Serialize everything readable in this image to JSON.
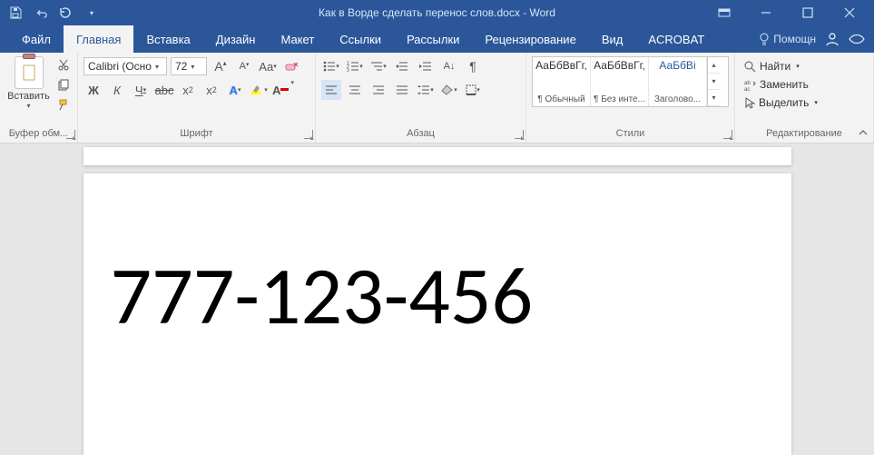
{
  "titlebar": {
    "title": "Как в Ворде сделать перенос слов.docx - Word"
  },
  "menu": {
    "tabs": [
      "Файл",
      "Главная",
      "Вставка",
      "Дизайн",
      "Макет",
      "Ссылки",
      "Рассылки",
      "Рецензирование",
      "Вид",
      "ACROBAT"
    ],
    "active_index": 1,
    "tell_me": "Помощн"
  },
  "ribbon": {
    "clipboard": {
      "paste": "Вставить",
      "group": "Буфер обм..."
    },
    "font": {
      "name": "Calibri (Осно",
      "size": "72",
      "group": "Шрифт",
      "btns": {
        "bold": "Ж",
        "italic": "К",
        "underline": "Ч",
        "strike": "abc",
        "sub": "x",
        "sup": "x",
        "case": "Aa",
        "clear": "",
        "inc": "A",
        "dec": "A"
      }
    },
    "para": {
      "group": "Абзац"
    },
    "styles": {
      "group": "Стили",
      "preview": "АаБбВвГг,",
      "items": [
        "¶ Обычный",
        "¶ Без инте...",
        "Заголово..."
      ],
      "preview3": "АаБбВі"
    },
    "editing": {
      "group": "Редактирование",
      "find": "Найти",
      "replace": "Заменить",
      "select": "Выделить"
    }
  },
  "document": {
    "text": "777-123-456"
  }
}
